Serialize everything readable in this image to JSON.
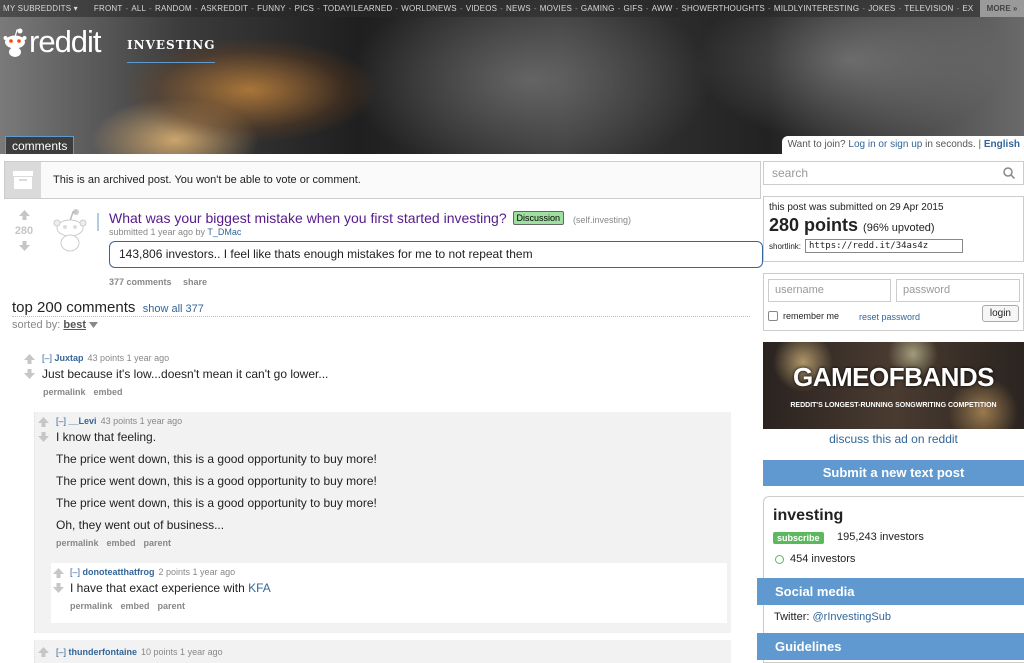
{
  "header": {
    "srbar_items": [
      "MY SUBREDDITS ▾",
      "FRONT",
      "ALL",
      "RANDOM",
      "ASKREDDIT",
      "FUNNY",
      "PICS",
      "TODAYILEARNED",
      "WORLDNEWS",
      "VIDEOS",
      "NEWS",
      "MOVIES",
      "GAMING",
      "GIFS",
      "AWW",
      "SHOWERTHOUGHTS",
      "MILDLYINTERESTING",
      "JOKES",
      "TELEVISION",
      "EX"
    ],
    "more_label": "MORE »",
    "logo_text": "reddit",
    "subreddit_name": "INVESTING",
    "tab_label": "comments",
    "login_prefix": "Want to join?",
    "login_link": "Log in or sign up",
    "login_suffix": "in seconds.",
    "language": "English"
  },
  "archived_notice": "This is an archived post. You won't be able to vote or comment.",
  "post": {
    "score": "280",
    "title": "What was your biggest mistake when you first started investing?",
    "flair": "Discussion",
    "domain": "(self.investing)",
    "tagline_prefix": "submitted 1 year ago by",
    "author": "T_DMac",
    "selftext": "143,806 investors.. I feel like thats enough mistakes for me to not repeat them",
    "comments_count": "377 comments",
    "share": "share"
  },
  "comments_header": {
    "title": "top 200 comments",
    "show_all": "show all 377",
    "sorted_label": "sorted by:",
    "sort_value": "best"
  },
  "comments": [
    {
      "expander": "[–]",
      "author": "Juxtap",
      "meta": "43 points 1 year ago",
      "lines": [
        "Just because it's low...doesn't mean it can't go lower..."
      ],
      "links": [
        "permalink",
        "embed"
      ]
    },
    {
      "expander": "[–]",
      "author": "__Levi",
      "meta": "43 points 1 year ago",
      "lines": [
        "I know that feeling.",
        "The price went down, this is a good opportunity to buy more!",
        "The price went down, this is a good opportunity to buy more!",
        "The price went down, this is a good opportunity to buy more!",
        "Oh, they went out of business..."
      ],
      "links": [
        "permalink",
        "embed",
        "parent"
      ]
    },
    {
      "expander": "[–]",
      "author": "donoteatthatfrog",
      "meta": "2 points 1 year ago",
      "text_prefix": "I have that exact experience with",
      "link_text": "KFA",
      "links": [
        "permalink",
        "embed",
        "parent"
      ]
    },
    {
      "expander": "[–]",
      "author": "thunderfontaine",
      "meta": "10 points 1 year ago"
    }
  ],
  "sidebar": {
    "search_placeholder": "search",
    "submitted_on": "this post was submitted on 29 Apr 2015",
    "points": "280 points",
    "upvoted": "(96% upvoted)",
    "shortlink_label": "shortlink:",
    "shortlink": "https://redd.it/34as4z",
    "username_placeholder": "username",
    "password_placeholder": "password",
    "remember_me": "remember me",
    "reset_password": "reset password",
    "login_button": "login",
    "ad_title": "GAMEOFBANDS",
    "ad_subtitle": "REDDIT'S LONGEST-RUNNING SONGWRITING COMPETITION",
    "discuss_ad": "discuss this ad on reddit",
    "submit_button": "Submit a new text post",
    "subreddit": "investing",
    "subscribe": "subscribe",
    "subscribers": "195,243 investors",
    "online": "454 investors",
    "social_media": "Social media",
    "twitter_label": "Twitter:",
    "twitter_handle": "@rInvestingSub",
    "guidelines": "Guidelines"
  },
  "colors": {
    "link": "#336699",
    "accent": "#5f99cf",
    "visited_title": "#551a8b",
    "flair_bg": "#9fdf9f"
  }
}
